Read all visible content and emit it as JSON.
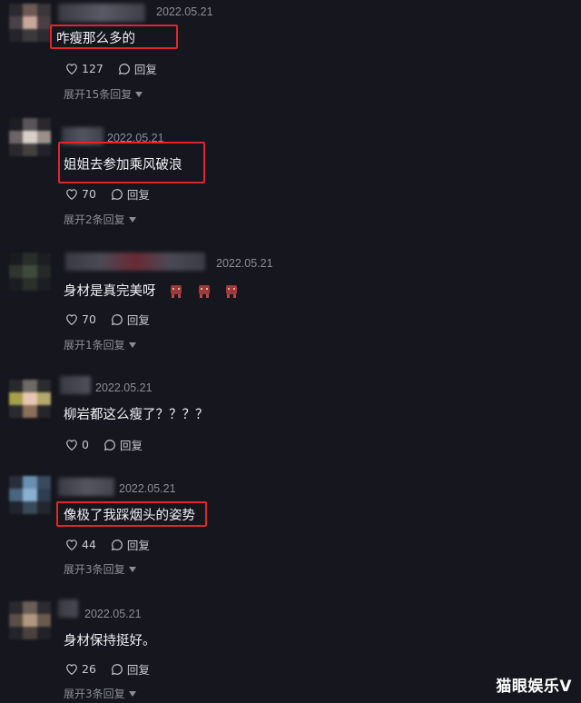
{
  "comments": [
    {
      "date": "2022.05.21",
      "text": "咋瘦那么多的",
      "likes": "127",
      "reply_label": "回复",
      "expand": "展开15条回复",
      "highlighted": true
    },
    {
      "date": "2022.05.21",
      "text": "姐姐去参加乘风破浪",
      "likes": "70",
      "reply_label": "回复",
      "expand": "展开2条回复",
      "highlighted": true
    },
    {
      "date": "2022.05.21",
      "text": "身材是真完美呀",
      "likes": "70",
      "reply_label": "回复",
      "expand": "展开1条回复",
      "highlighted": false,
      "emoji_icons": [
        "crying-emoji-icon",
        "crying-emoji-icon",
        "crying-emoji-icon"
      ]
    },
    {
      "date": "2022.05.21",
      "text": "柳岩都这么瘦了？？？？",
      "likes": "0",
      "reply_label": "回复",
      "highlighted": false
    },
    {
      "date": "2022.05.21",
      "text": "像极了我踩烟头的姿势",
      "likes": "44",
      "reply_label": "回复",
      "expand": "展开3条回复",
      "highlighted": true
    },
    {
      "date": "2022.05.21",
      "text": "身材保持挺好。",
      "likes": "26",
      "reply_label": "回复",
      "expand": "展开3条回复",
      "highlighted": false
    }
  ],
  "watermark": "猫眼娱乐V",
  "colors": {
    "background": "#15161e",
    "highlight_box": "#e0262b",
    "meta_text": "#8c8d96"
  }
}
